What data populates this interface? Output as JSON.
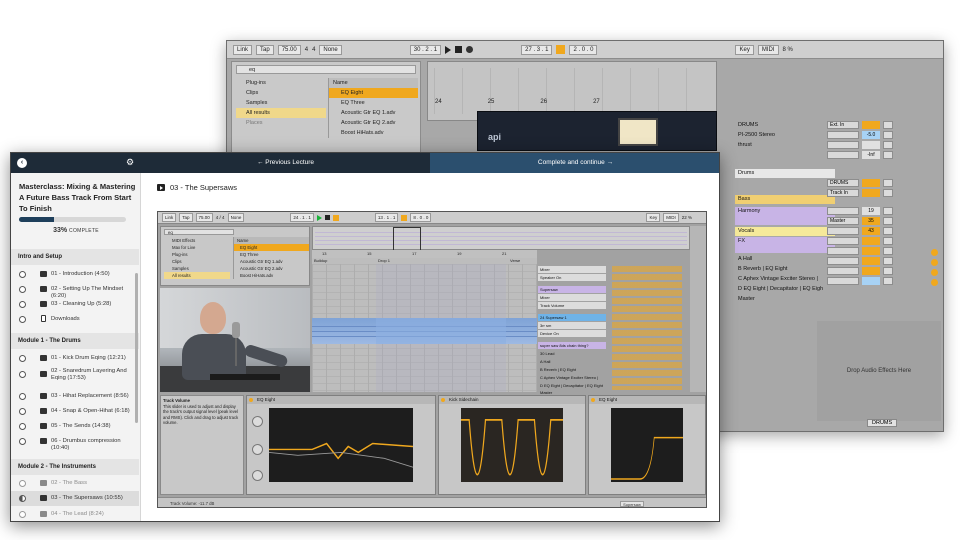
{
  "background_app": {
    "transport": {
      "link": "Link",
      "tap": "Tap",
      "tempo": "75.00",
      "sig_num": "4",
      "sig_den": "4",
      "quant": "None",
      "position": "30 . 2 . 1",
      "loop_start": "27 . 3 . 1",
      "loop_len": "2 . 0 . 0",
      "key": "Key",
      "midi": "MIDI",
      "cpu": "8 %"
    },
    "browser": {
      "search_value": "eq",
      "categories": [
        "Plug-ins",
        "Clips",
        "Samples",
        "All results",
        "Places"
      ],
      "files_header": "Name",
      "files": [
        "EQ Eight",
        "EQ Three",
        "Acoustic Gtr EQ 1.adv",
        "Acoustic Gtr EQ 2.adv",
        "Boost HiHats.adv"
      ]
    },
    "ruler": [
      "24",
      "25",
      "26",
      "27"
    ],
    "plugin_name": "api",
    "mixer": {
      "tracks": [
        "DRUMS",
        "PI-2500 Stereo",
        "thrust",
        "Drums",
        "Bass",
        "Harmony",
        "Vocals",
        "FX",
        "A Hall",
        "B Reverb | EQ Eight",
        "C Aphex Vintage Exciter Stereo |",
        "D EQ Eight | Decapitator | EQ Eigh",
        "Master"
      ],
      "io": [
        "Ext. In",
        "DRUMS",
        "Track In",
        "Master"
      ],
      "values": [
        "-5.0",
        "-Inf",
        "19",
        "35",
        "43"
      ]
    },
    "drop_text": "Drop Audio Effects Here",
    "footer_track": "DRUMS"
  },
  "course": {
    "topbar": {
      "back_icon": "chevron-left-icon",
      "gear_icon": "gear-icon",
      "prev_label": "← Previous Lecture",
      "next_label": "Complete and continue →"
    },
    "title": "Masterclass: Mixing & Mastering A Future Bass Track From Start To Finish",
    "progress": {
      "percent": "33%",
      "fraction": 0.33,
      "suffix": "COMPLETE"
    },
    "sections": [
      {
        "title": "Intro and Setup",
        "lessons": [
          {
            "label": "01 - Introduction (4:50)",
            "type": "video",
            "state": "open"
          },
          {
            "label": "02 - Setting Up The Mindset (6:20)",
            "type": "video",
            "state": "open"
          },
          {
            "label": "03 - Cleaning Up (5:28)",
            "type": "video",
            "state": "open"
          },
          {
            "label": "Downloads",
            "type": "doc",
            "state": "open"
          }
        ]
      },
      {
        "title": "Module 1 - The Drums",
        "lessons": [
          {
            "label": "01 - Kick Drum Eqing (12:21)",
            "type": "video",
            "state": "open"
          },
          {
            "label": "02 - Snaredrum Layering And Eqing (17:53)",
            "type": "video",
            "state": "open"
          },
          {
            "label": "03 - Hihat Replacement (8:56)",
            "type": "video",
            "state": "open"
          },
          {
            "label": "04 - Snap & Open-Hihat (6:18)",
            "type": "video",
            "state": "open"
          },
          {
            "label": "05 - The Sends (14:38)",
            "type": "video",
            "state": "open"
          },
          {
            "label": "06 - Drumbus compression (10:40)",
            "type": "video",
            "state": "open"
          }
        ]
      },
      {
        "title": "Module 2 - The Instruments",
        "lessons": [
          {
            "label": "02 - The Bass",
            "type": "video",
            "state": "done"
          },
          {
            "label": "03 - The Supersaws (10:55)",
            "type": "video",
            "state": "current"
          },
          {
            "label": "04 - The Lead (8:24)",
            "type": "video",
            "state": "done"
          }
        ]
      }
    ],
    "lecture_title": "03 - The Supersaws",
    "video": {
      "transport": {
        "link": "Link",
        "tap": "Tap",
        "tempo": "75.00",
        "sig": "4 / 4",
        "quant": "None",
        "position": "24 . 1 . 1",
        "loop_start": "13 . 1 . 1",
        "loop_len": "8 . 0 . 0",
        "key": "Key",
        "midi": "MIDI",
        "cpu": "22 %"
      },
      "browser": {
        "search_value": "eq",
        "categories": [
          "MIDI Effects",
          "Max for Live",
          "Plug-ins",
          "Clips",
          "Samples",
          "All results"
        ],
        "files_header": "Name",
        "files": [
          "EQ Eight",
          "EQ Three",
          "Acoustic Gtr EQ 1.adv",
          "Acoustic Gtr EQ 2.adv",
          "Boost HiHats.adv"
        ]
      },
      "ruler": [
        "13",
        "15",
        "17",
        "19",
        "21"
      ],
      "markers": [
        "Buildup",
        "Drop 1",
        "Verse"
      ],
      "tracks": [
        "Mixer",
        "Speaker On",
        "Supersaw",
        "Mixer",
        "Track Volume",
        "24 Supersaw 1",
        "3rr sm",
        "Device On",
        "super saw 8ds chain thing?",
        "30 Lead",
        "A Hall",
        "B Reverb | EQ Eight",
        "C Aphex Vintage Exciter Stereo |",
        "D EQ Eight | Decapitator | EQ Eight",
        "Master"
      ],
      "info_title": "Track Volume",
      "info_text": "This slider is used to adjust and display the track's output signal level (peak level and RMS). Click and drag to adjust track volume.",
      "devices": [
        "EQ Eight",
        "Kick Sidechain",
        "EQ Eight"
      ],
      "status": "Track Volume: -11.7 dB",
      "status_right": "Supersaw"
    }
  }
}
